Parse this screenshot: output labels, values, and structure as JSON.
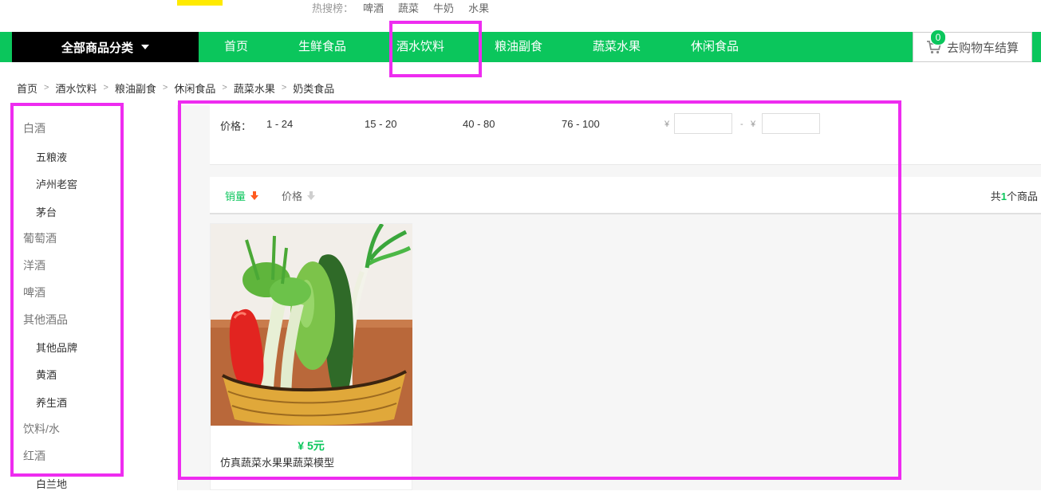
{
  "hot_search": {
    "label": "热搜榜：",
    "keywords": [
      "啤酒",
      "蔬菜",
      "牛奶",
      "水果"
    ]
  },
  "nav": {
    "all_categories": "全部商品分类",
    "items": [
      "首页",
      "生鲜食品",
      "酒水饮料",
      "粮油副食",
      "蔬菜水果",
      "休闲食品"
    ],
    "cart_label": "去购物车结算",
    "cart_count": "0"
  },
  "breadcrumb": [
    "首页",
    "酒水饮料",
    "粮油副食",
    "休闲食品",
    "蔬菜水果",
    "奶类食品"
  ],
  "sidebar": {
    "categories": [
      {
        "label": "白酒",
        "level": 1
      },
      {
        "label": "五粮液",
        "level": 2
      },
      {
        "label": "泸州老窖",
        "level": 2
      },
      {
        "label": "茅台",
        "level": 2
      },
      {
        "label": "葡萄酒",
        "level": 1
      },
      {
        "label": "洋酒",
        "level": 1
      },
      {
        "label": "啤酒",
        "level": 1
      },
      {
        "label": "其他酒品",
        "level": 1
      },
      {
        "label": "其他品牌",
        "level": 2
      },
      {
        "label": "黄酒",
        "level": 2
      },
      {
        "label": "养生酒",
        "level": 2
      },
      {
        "label": "饮料/水",
        "level": 1
      },
      {
        "label": "红酒",
        "level": 1
      },
      {
        "label": "白兰地",
        "level": 2
      }
    ]
  },
  "price_filter": {
    "label": "价格：",
    "ranges": [
      "1 - 24",
      "15 - 20",
      "40 - 80",
      "76 - 100"
    ],
    "currency": "¥",
    "dash": "-"
  },
  "sort": {
    "sales_label": "销量",
    "price_label": "价格",
    "count_prefix": "共",
    "count_value": "1",
    "count_suffix": "个商品"
  },
  "products": [
    {
      "price": "¥ 5元",
      "name": "仿真蔬菜水果果蔬菜模型"
    }
  ],
  "colors": {
    "brand_green": "#0bc65c",
    "highlight": "#ee2cf0",
    "nav_black": "#000000"
  }
}
